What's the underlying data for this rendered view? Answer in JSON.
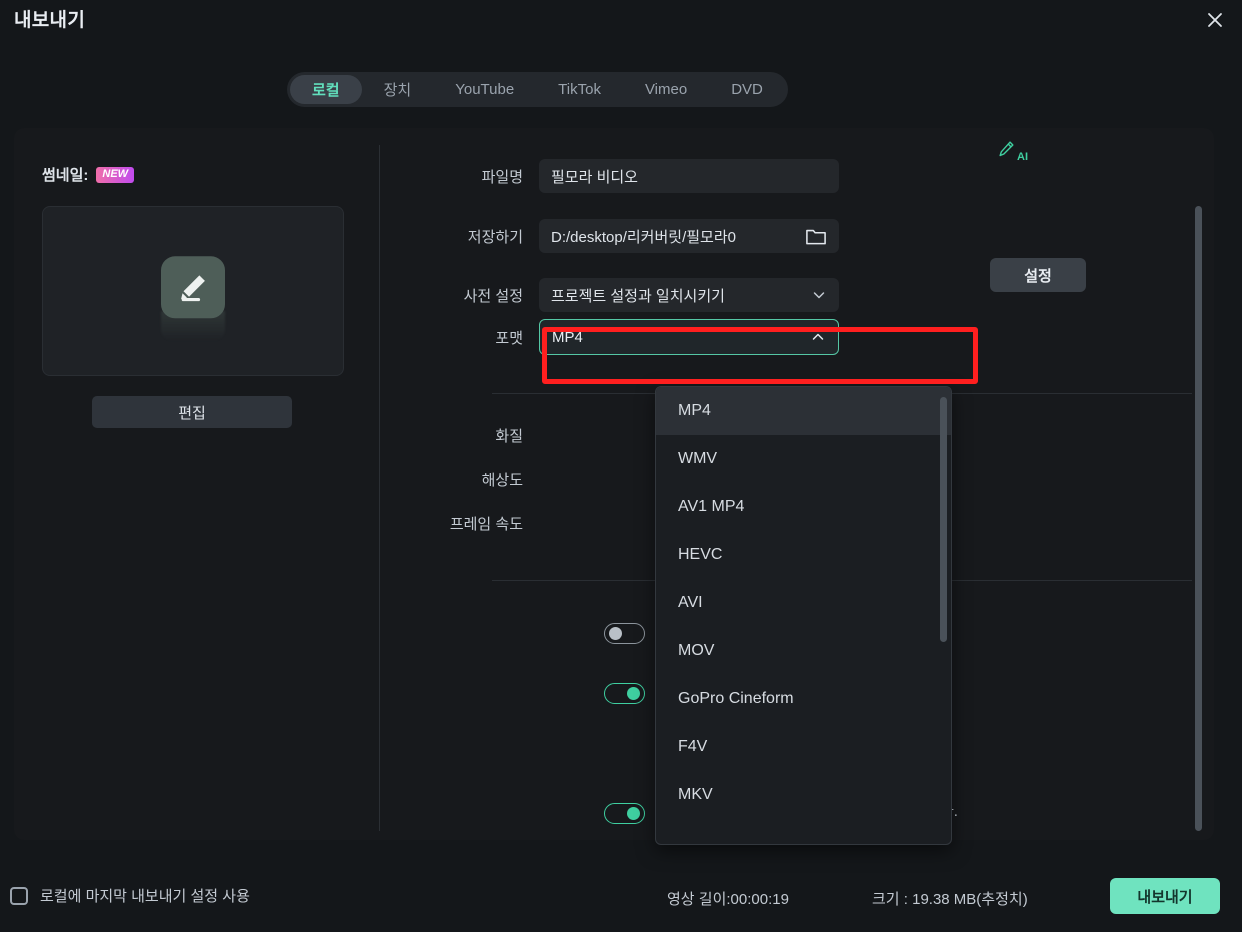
{
  "dialog": {
    "title": "내보내기",
    "close_icon": "close-icon"
  },
  "tabs": [
    {
      "label": "로컬",
      "active": true
    },
    {
      "label": "장치",
      "active": false
    },
    {
      "label": "YouTube",
      "active": false
    },
    {
      "label": "TikTok",
      "active": false
    },
    {
      "label": "Vimeo",
      "active": false
    },
    {
      "label": "DVD",
      "active": false
    }
  ],
  "thumbnail": {
    "label": "썸네일:",
    "badge": "NEW",
    "edit_button": "편집",
    "preview_icon": "pencil-edit-icon"
  },
  "form": {
    "filename": {
      "label": "파일명",
      "value": "필모라 비디오"
    },
    "save_to": {
      "label": "저장하기",
      "value": "D:/desktop/리커버릿/필모라0",
      "icon": "folder-icon"
    },
    "preset": {
      "label": "사전 설정",
      "value": "프로젝트 설정과 일치시키기",
      "icon": "chevron-down-icon"
    },
    "settings_button": "설정",
    "ai_icon_label": "AI",
    "format": {
      "label": "포맷",
      "value": "MP4",
      "icon": "chevron-up-icon"
    },
    "quality": {
      "label": "화질"
    },
    "resolution": {
      "label": "해상도"
    },
    "framerate": {
      "label": "프레임 속도"
    },
    "obscured_text": "다.",
    "toggles": [
      {
        "state": "off"
      },
      {
        "state": "on"
      },
      {
        "state": "on"
      }
    ]
  },
  "dropdown": {
    "options": [
      "MP4",
      "WMV",
      "AV1 MP4",
      "HEVC",
      "AVI",
      "MOV",
      "GoPro Cineform",
      "F4V",
      "MKV"
    ],
    "selected": "MP4"
  },
  "footer": {
    "checkbox_label": "로컬에 마지막 내보내기 설정 사용",
    "checkbox_checked": false,
    "duration": "영상 길이:00:00:19",
    "size": "크기 : 19.38 MB(추정치)",
    "export_button": "내보내기"
  },
  "colors": {
    "accent": "#6fe3bf",
    "accent_border": "#55c7a5",
    "highlight_rect": "#ff1f1f",
    "background": "#14171a",
    "panel": "#17191c"
  }
}
